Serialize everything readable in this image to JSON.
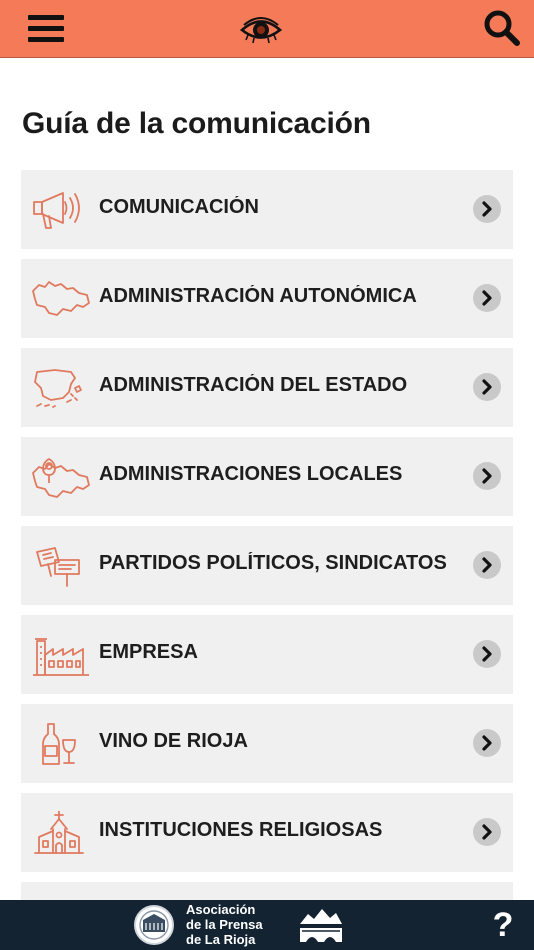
{
  "header": {
    "menu_icon": "hamburger-menu-icon",
    "logo_icon": "eye-icon",
    "search_icon": "search-icon",
    "background_color": "#f57a57"
  },
  "page": {
    "title": "Guía de la comunicación"
  },
  "categories": [
    {
      "label": "COMUNICACIÓN",
      "icon": "megaphone-icon"
    },
    {
      "label": "ADMINISTRACIÓN AUTONÓMICA",
      "icon": "la-rioja-map-icon"
    },
    {
      "label": "ADMINISTRACIÓN DEL ESTADO",
      "icon": "spain-map-icon"
    },
    {
      "label": "ADMINISTRACIONES LOCALES",
      "icon": "map-pin-icon"
    },
    {
      "label": "PARTIDOS POLÍTICOS, SINDICATOS",
      "icon": "protest-signs-icon"
    },
    {
      "label": "EMPRESA",
      "icon": "factory-icon"
    },
    {
      "label": "VINO DE RIOJA",
      "icon": "wine-bottle-glass-icon"
    },
    {
      "label": "INSTITUCIONES RELIGIOSAS",
      "icon": "church-icon"
    }
  ],
  "footer": {
    "association_lines": [
      "Asociación",
      "de la Prensa",
      "de La Rioja"
    ],
    "association_seal_icon": "association-seal-icon",
    "rioja_logo_icon": "rioja-bridge-logo-icon",
    "help_label": "?",
    "background_color": "#132332"
  },
  "colors": {
    "accent": "#f57a57",
    "icon_stroke": "#e07a5f",
    "row_background": "#f0f0f0",
    "chevron_background": "#c9c9c9"
  }
}
